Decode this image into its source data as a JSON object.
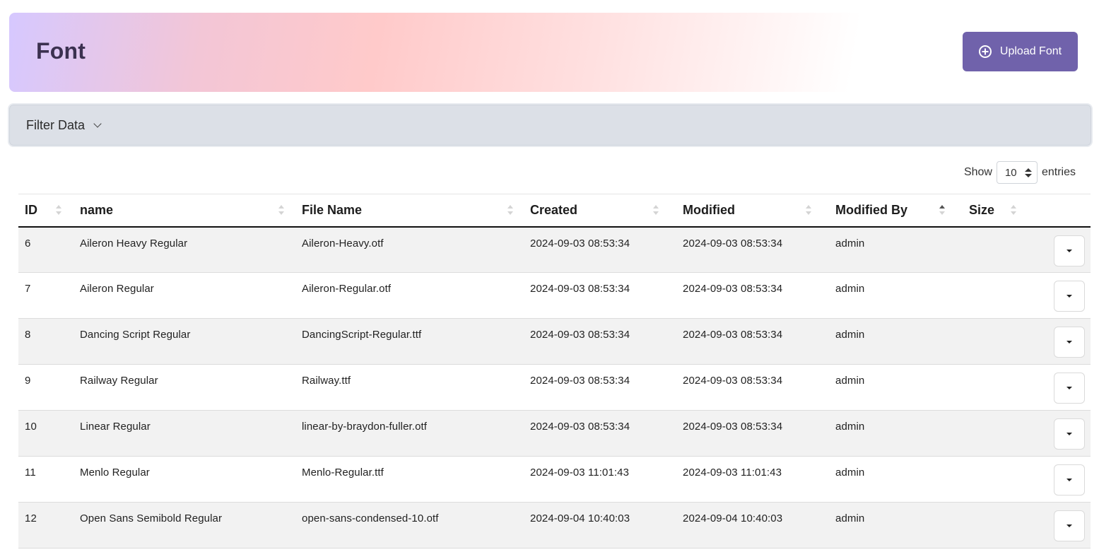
{
  "header": {
    "title": "Font",
    "upload_button": {
      "label": "Upload Font",
      "icon": "plus-circle-icon"
    },
    "gradient_colors": [
      "#d6c8ff",
      "#ffcaca",
      "#ffffff"
    ],
    "button_color": "#7062ab"
  },
  "filter": {
    "label": "Filter Data",
    "icon": "chevron-down-icon"
  },
  "entries": {
    "show_label": "Show",
    "selected": "10",
    "suffix_label": "entries"
  },
  "table": {
    "columns": [
      {
        "label": "ID",
        "sortable": true
      },
      {
        "label": "name",
        "sortable": true
      },
      {
        "label": "File Name",
        "sortable": true
      },
      {
        "label": "Created",
        "sortable": true
      },
      {
        "label": "Modified",
        "sortable": true
      },
      {
        "label": "Modified By",
        "sortable": true,
        "sorted": "asc"
      },
      {
        "label": "Size",
        "sortable": true
      },
      {
        "label": "",
        "sortable": false
      }
    ],
    "rows": [
      {
        "id": "6",
        "name": "Aileron Heavy Regular",
        "file": "Aileron-Heavy.otf",
        "created": "2024-09-03 08:53:34",
        "modified": "2024-09-03 08:53:34",
        "modified_by": "admin",
        "size": ""
      },
      {
        "id": "7",
        "name": "Aileron Regular",
        "file": "Aileron-Regular.otf",
        "created": "2024-09-03 08:53:34",
        "modified": "2024-09-03 08:53:34",
        "modified_by": "admin",
        "size": ""
      },
      {
        "id": "8",
        "name": "Dancing Script Regular",
        "file": "DancingScript-Regular.ttf",
        "created": "2024-09-03 08:53:34",
        "modified": "2024-09-03 08:53:34",
        "modified_by": "admin",
        "size": ""
      },
      {
        "id": "9",
        "name": "Railway Regular",
        "file": "Railway.ttf",
        "created": "2024-09-03 08:53:34",
        "modified": "2024-09-03 08:53:34",
        "modified_by": "admin",
        "size": ""
      },
      {
        "id": "10",
        "name": "Linear Regular",
        "file": "linear-by-braydon-fuller.otf",
        "created": "2024-09-03 08:53:34",
        "modified": "2024-09-03 08:53:34",
        "modified_by": "admin",
        "size": ""
      },
      {
        "id": "11",
        "name": "Menlo Regular",
        "file": "Menlo-Regular.ttf",
        "created": "2024-09-03 11:01:43",
        "modified": "2024-09-03 11:01:43",
        "modified_by": "admin",
        "size": ""
      },
      {
        "id": "12",
        "name": "Open Sans Semibold Regular",
        "file": "open-sans-condensed-10.otf",
        "created": "2024-09-04 10:40:03",
        "modified": "2024-09-04 10:40:03",
        "modified_by": "admin",
        "size": ""
      }
    ],
    "row_action_icon": "caret-down-icon"
  }
}
